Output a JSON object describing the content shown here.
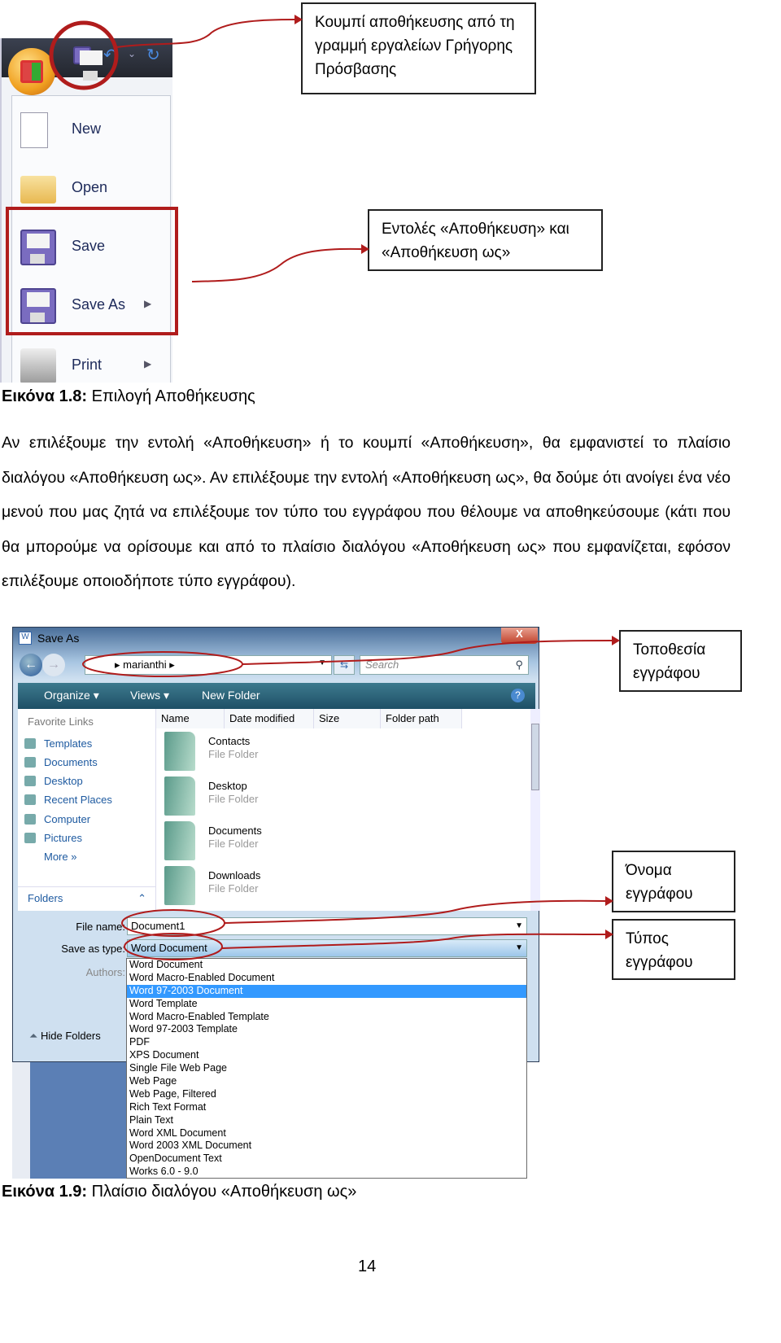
{
  "callouts": {
    "qat_save": [
      "Κουμπί αποθήκευσης από τη",
      "γραμμή εργαλείων Γρήγορης",
      "Πρόσβασης"
    ],
    "save_commands": [
      "Εντολές «Αποθήκευση» και",
      "«Αποθήκευση ως»"
    ],
    "location": [
      "Τοποθεσία",
      "εγγράφου"
    ],
    "filename": [
      "Όνομα",
      "εγγράφου"
    ],
    "filetype": [
      "Τύπος",
      "εγγράφου"
    ]
  },
  "office_menu": {
    "items": [
      {
        "label": "New",
        "icon": "new-document-icon"
      },
      {
        "label": "Open",
        "icon": "open-folder-icon"
      },
      {
        "label": "Save",
        "icon": "save-disk-icon"
      },
      {
        "label": "Save As",
        "icon": "save-as-icon",
        "submenu": true
      },
      {
        "label": "Print",
        "icon": "printer-icon",
        "submenu": true
      }
    ]
  },
  "figure1_caption": {
    "label": "Εικόνα 1.8:",
    "text": " Επιλογή Αποθήκευσης"
  },
  "paragraph": "Αν επιλέξουμε την εντολή «Αποθήκευση» ή το κουμπί «Αποθήκευση», θα εμφανιστεί το πλαίσιο διαλόγου «Αποθήκευση ως». Αν επιλέξουμε την εντολή «Αποθήκευση ως», θα δούμε ότι ανοίγει ένα νέο μενού που μας ζητά να επιλέξουμε τον τύπο του εγγράφου που θέλουμε να αποθηκεύσουμε (κάτι που θα μπορούμε να ορίσουμε και από το πλαίσιο διαλόγου «Αποθήκευση ως» που εμφανίζεται, εφόσον επιλέξουμε οποιοδήποτε τύπο εγγράφου).",
  "dialog": {
    "title": "Save As",
    "close": "X",
    "address": "marianthi",
    "search_placeholder": "Search",
    "toolbar": {
      "organize": "Organize ▾",
      "views": "Views ▾",
      "new_folder": "New Folder",
      "help": "?"
    },
    "favorite_links_header": "Favorite Links",
    "favorite_links": [
      "Templates",
      "Documents",
      "Desktop",
      "Recent Places",
      "Computer",
      "Pictures"
    ],
    "more": "More »",
    "folders": "Folders",
    "columns": [
      "Name",
      "Date modified",
      "Size",
      "Folder path"
    ],
    "files": [
      {
        "name": "Contacts",
        "type": "File Folder"
      },
      {
        "name": "Desktop",
        "type": "File Folder"
      },
      {
        "name": "Documents",
        "type": "File Folder"
      },
      {
        "name": "Downloads",
        "type": "File Folder"
      }
    ],
    "file_name_label": "File name:",
    "file_name": "Document1",
    "save_as_type_label": "Save as type:",
    "save_as_type": "Word Document",
    "authors_label": "Authors:",
    "hide_folders": "Hide Folders",
    "type_options": [
      "Word Document",
      "Word Macro-Enabled Document",
      "Word 97-2003 Document",
      "Word Template",
      "Word Macro-Enabled Template",
      "Word 97-2003 Template",
      "PDF",
      "XPS Document",
      "Single File Web Page",
      "Web Page",
      "Web Page, Filtered",
      "Rich Text Format",
      "Plain Text",
      "Word XML Document",
      "Word 2003 XML Document",
      "OpenDocument Text",
      "Works 6.0 - 9.0"
    ],
    "highlighted_option": "Word 97-2003 Document"
  },
  "figure2_caption": {
    "label": "Εικόνα 1.9:",
    "text": " Πλαίσιο διαλόγου «Αποθήκευση ως»"
  },
  "page_number": "14",
  "colors": {
    "annotation_red": "#b01c1c",
    "selection_blue": "#3399ff"
  }
}
